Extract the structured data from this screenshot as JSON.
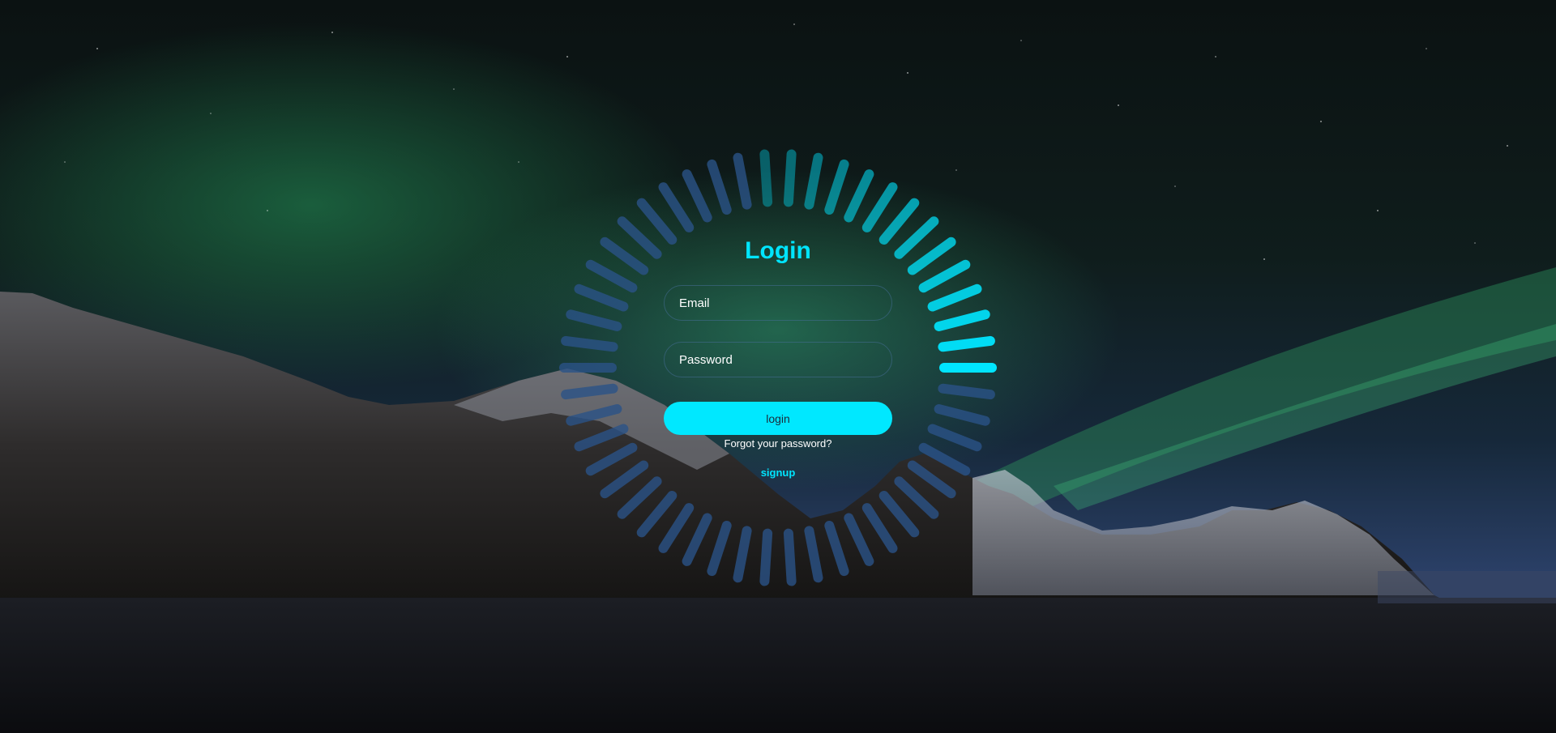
{
  "login": {
    "title": "Login",
    "email_placeholder": "Email",
    "password_placeholder": "Password",
    "submit_label": "login",
    "forgot_link": "Forgot your password?",
    "signup_link": "signup"
  },
  "loader": {
    "bar_count": 50,
    "base_color": "#2b5287",
    "active_color": "#00e5ff"
  },
  "colors": {
    "accent": "#00e5ff",
    "button": "#00e8ff"
  }
}
